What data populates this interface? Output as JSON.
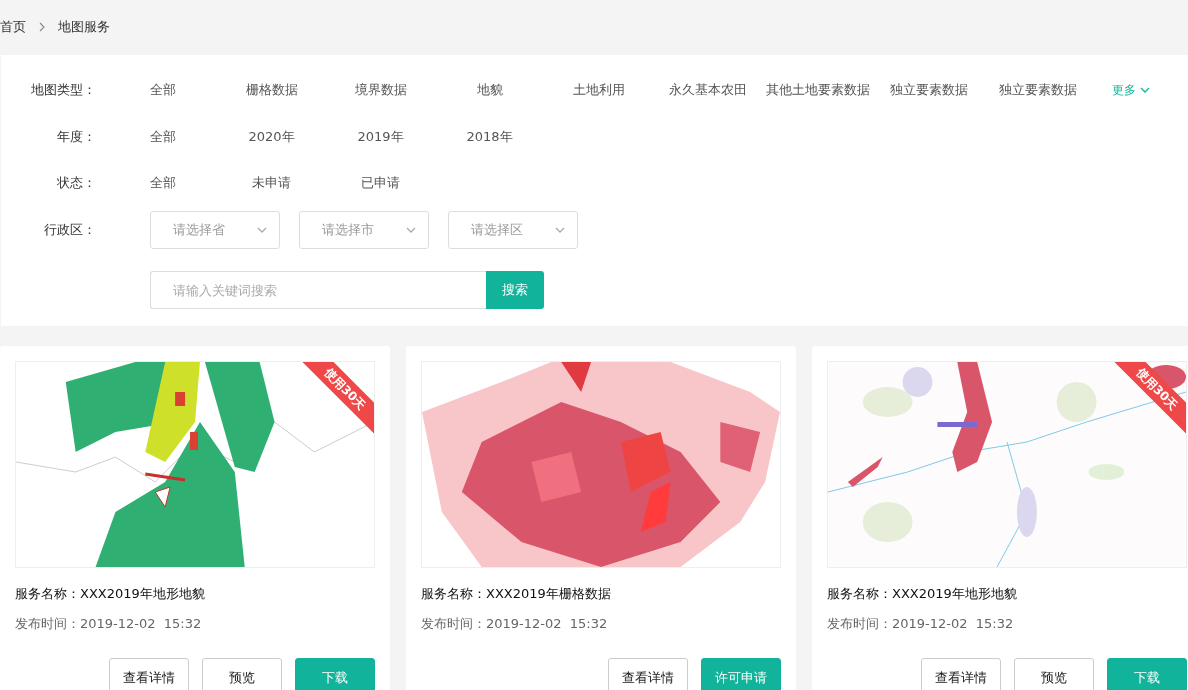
{
  "breadcrumb": [
    {
      "label": "首页"
    },
    {
      "label": "地图服务"
    }
  ],
  "filters": [
    {
      "kind": "options",
      "label": "地图类型：",
      "options": [
        {
          "label": "全部",
          "selected": false
        },
        {
          "label": "栅格数据",
          "selected": false
        },
        {
          "label": "境界数据",
          "selected": false
        },
        {
          "label": "地貌",
          "selected": false
        },
        {
          "label": "土地利用",
          "selected": false
        },
        {
          "label": "永久基本农田",
          "selected": false
        },
        {
          "label": "其他土地要素数据",
          "selected": false
        },
        {
          "label": "独立要素数据",
          "selected": false
        },
        {
          "label": "独立要素数据",
          "selected": false
        }
      ],
      "more": "更多"
    },
    {
      "kind": "options",
      "label": "年度：",
      "options": [
        {
          "label": "全部",
          "selected": false
        },
        {
          "label": "2020年",
          "selected": false
        },
        {
          "label": "2019年",
          "selected": false
        },
        {
          "label": "2018年",
          "selected": false
        }
      ]
    },
    {
      "kind": "options",
      "label": "状态：",
      "options": [
        {
          "label": "全部",
          "selected": false
        },
        {
          "label": "未申请",
          "selected": false
        },
        {
          "label": "已申请",
          "selected": false
        }
      ]
    },
    {
      "kind": "selects",
      "label": "行政区：",
      "selects": [
        {
          "placeholder": "请选择省"
        },
        {
          "placeholder": "请选择市"
        },
        {
          "placeholder": "请选择区"
        }
      ]
    },
    {
      "kind": "search",
      "placeholder": "请输入关键词搜索",
      "button": "搜索"
    }
  ],
  "cards": [
    {
      "ribbon": "使用30天",
      "name_label": "服务名称：",
      "name": "XXX2019年地形地貌",
      "time_label": "发布时间：",
      "time": "2019-12-02  15:32",
      "buttons": [
        {
          "label": "查看详情",
          "primary": false
        },
        {
          "label": "预览",
          "primary": false
        },
        {
          "label": "下载",
          "primary": true
        }
      ]
    },
    {
      "name_label": "服务名称：",
      "name": "XXX2019年栅格数据",
      "time_label": "发布时间：",
      "time": "2019-12-02  15:32",
      "buttons": [
        {
          "label": "查看详情",
          "primary": false
        },
        {
          "label": "许可申请",
          "primary": true
        }
      ]
    },
    {
      "ribbon": "使用30天",
      "name_label": "服务名称：",
      "name": "XXX2019年地形地貌",
      "time_label": "发布时间：",
      "time": "2019-12-02  15:32",
      "buttons": [
        {
          "label": "查看详情",
          "primary": false
        },
        {
          "label": "预览",
          "primary": false
        },
        {
          "label": "下载",
          "primary": true
        }
      ]
    }
  ]
}
